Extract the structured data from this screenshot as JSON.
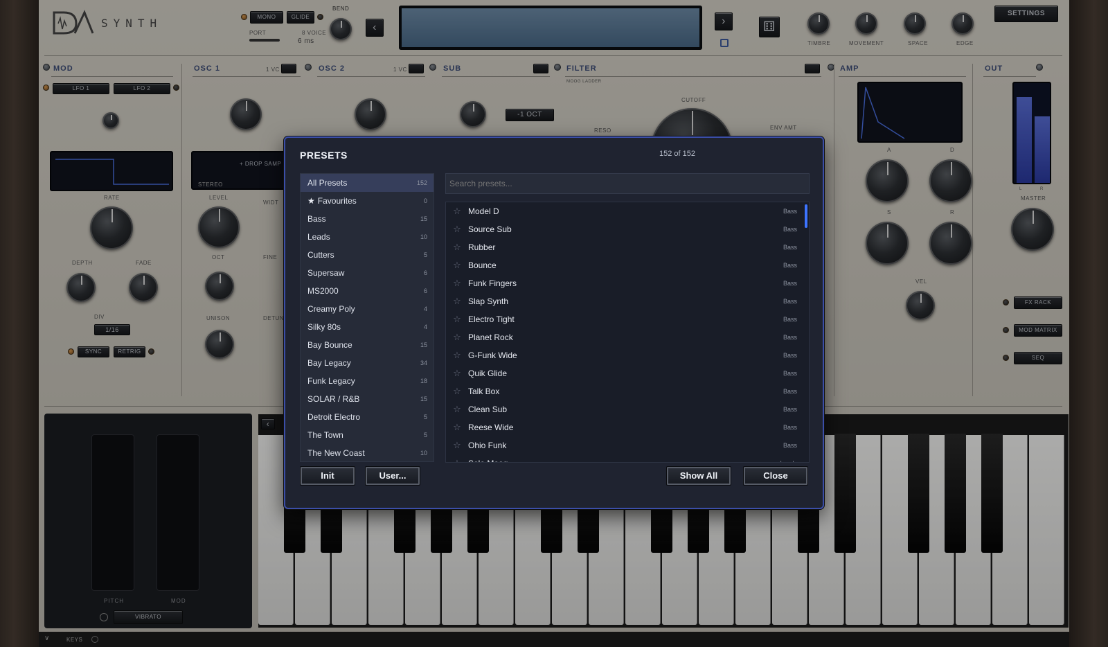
{
  "header": {
    "logo_text": "SYNTH",
    "mono_label": "MONO",
    "glide_label": "GLIDE",
    "bend_label": "BEND",
    "port_label": "PORT",
    "voice_label": "8 VOICE",
    "port_value": "6 ms",
    "settings_label": "SETTINGS",
    "macros": [
      "TIMBRE",
      "MOVEMENT",
      "SPACE",
      "EDGE"
    ]
  },
  "sections": {
    "mod": "MOD",
    "osc1": "OSC 1",
    "osc2": "OSC 2",
    "sub": "SUB",
    "filter": "FILTER",
    "amp": "AMP",
    "out": "OUT",
    "vc_label": "1 VC"
  },
  "mod": {
    "lfo1": "LFO 1",
    "lfo2": "LFO 2",
    "rate": "RATE",
    "depth": "DEPTH",
    "fade": "FADE",
    "div": "DIV",
    "div_value": "1/16",
    "sync": "SYNC",
    "retrig": "RETRIG"
  },
  "osc1": {
    "drop_sample": "+ DROP SAMP",
    "stereo": "STEREO",
    "level": "LEVEL",
    "width": "WIDT",
    "oct": "OCT",
    "fine": "FINE",
    "unison": "UNISON",
    "detune": "DETUN"
  },
  "sub": {
    "oct_value": "-1 OCT"
  },
  "filter": {
    "type": "MOOG LADDER",
    "cutoff": "CUTOFF",
    "reso": "RESO",
    "env_amt": "ENV AMT"
  },
  "amp": {
    "a": "A",
    "d": "D",
    "s": "S",
    "r": "R",
    "vel": "VEL"
  },
  "out": {
    "l": "L",
    "r": "R",
    "master": "MASTER",
    "fx_rack": "FX RACK",
    "mod_matrix": "MOD MATRIX",
    "seq": "SEQ"
  },
  "wheels": {
    "pitch": "PITCH",
    "mod": "MOD",
    "vibrato": "VIBRATO",
    "keys": "KEYS"
  },
  "presets": {
    "title": "PRESETS",
    "count_text": "152 of 152",
    "search_placeholder": "Search presets...",
    "categories": [
      {
        "label": "All Presets",
        "count": "152",
        "active": true
      },
      {
        "label": "Favourites",
        "count": "0",
        "star": true
      },
      {
        "label": "Bass",
        "count": "15"
      },
      {
        "label": "Leads",
        "count": "10"
      },
      {
        "label": "Cutters",
        "count": "5"
      },
      {
        "label": "Supersaw",
        "count": "6"
      },
      {
        "label": "MS2000",
        "count": "6"
      },
      {
        "label": "Creamy Poly",
        "count": "4"
      },
      {
        "label": "Silky 80s",
        "count": "4"
      },
      {
        "label": "Bay Bounce",
        "count": "15"
      },
      {
        "label": "Bay Legacy",
        "count": "34"
      },
      {
        "label": "Funk Legacy",
        "count": "18"
      },
      {
        "label": "SOLAR / R&B",
        "count": "15"
      },
      {
        "label": "Detroit Electro",
        "count": "5"
      },
      {
        "label": "The Town",
        "count": "5"
      },
      {
        "label": "The New Coast",
        "count": "10"
      }
    ],
    "items": [
      {
        "name": "Model D",
        "category": "Bass"
      },
      {
        "name": "Source Sub",
        "category": "Bass"
      },
      {
        "name": "Rubber",
        "category": "Bass"
      },
      {
        "name": "Bounce",
        "category": "Bass"
      },
      {
        "name": "Funk Fingers",
        "category": "Bass"
      },
      {
        "name": "Slap Synth",
        "category": "Bass"
      },
      {
        "name": "Electro Tight",
        "category": "Bass"
      },
      {
        "name": "Planet Rock",
        "category": "Bass"
      },
      {
        "name": "G-Funk Wide",
        "category": "Bass"
      },
      {
        "name": "Quik Glide",
        "category": "Bass"
      },
      {
        "name": "Talk Box",
        "category": "Bass"
      },
      {
        "name": "Clean Sub",
        "category": "Bass"
      },
      {
        "name": "Reese Wide",
        "category": "Bass"
      },
      {
        "name": "Ohio Funk",
        "category": "Bass"
      },
      {
        "name": "Solo Moog",
        "category": "Leads"
      }
    ],
    "init_label": "Init",
    "user_label": "User...",
    "show_all_label": "Show All",
    "close_label": "Close",
    "star_glyph": "☆",
    "filled_star_glyph": "★"
  },
  "colors": {
    "accent": "#3b4ea8",
    "scroll_accent": "#3d74ff",
    "section_title": "#3d4d78"
  }
}
